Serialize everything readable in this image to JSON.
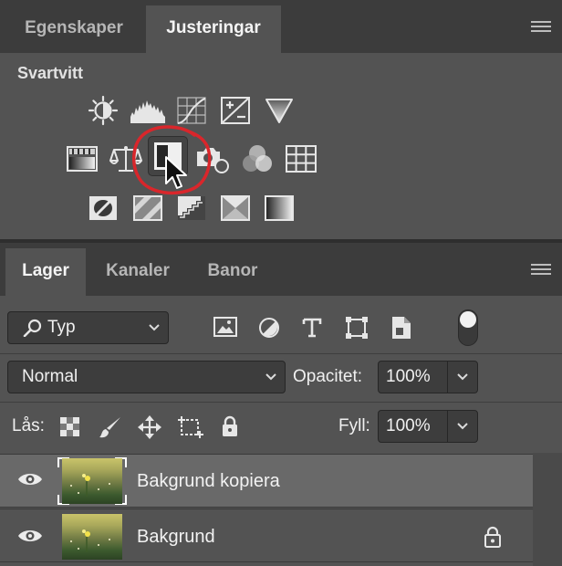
{
  "top_panel": {
    "tabs": [
      "Egenskaper",
      "Justeringar"
    ],
    "active_tab": "Justeringar",
    "section_title": "Svartvitt",
    "adjustment_rows": [
      [
        "brightness-contrast-icon",
        "levels-icon",
        "curves-icon",
        "exposure-icon",
        "vibrance-icon"
      ],
      [
        "hue-saturation-icon",
        "color-balance-icon",
        "black-white-icon",
        "photo-filter-icon",
        "channel-mixer-icon",
        "color-lookup-icon"
      ],
      [
        "invert-icon",
        "posterize-icon",
        "threshold-icon",
        "selective-color-icon",
        "gradient-map-icon"
      ]
    ],
    "highlighted_adjustment": "black-white-icon"
  },
  "layers_panel": {
    "tabs": [
      "Lager",
      "Kanaler",
      "Banor"
    ],
    "active_tab": "Lager",
    "filter_kind": "Typ",
    "blend_mode": "Normal",
    "opacity_label": "Opacitet:",
    "opacity_value": "100%",
    "lock_label": "Lås:",
    "fill_label": "Fyll:",
    "fill_value": "100%",
    "layers": [
      {
        "name": "Bakgrund kopiera",
        "visible": true,
        "selected": true,
        "locked": false
      },
      {
        "name": "Bakgrund",
        "visible": true,
        "selected": false,
        "locked": true
      }
    ]
  },
  "colors": {
    "panel_bg": "#535353",
    "tab_bar": "#3c3c3c",
    "highlight_ring": "#d9262b",
    "selected_row": "#696969"
  }
}
